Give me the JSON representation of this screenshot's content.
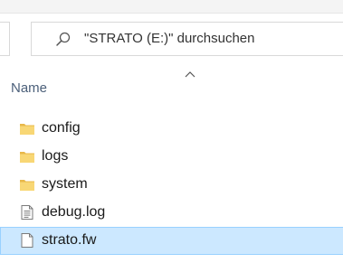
{
  "search": {
    "placeholder": "\"STRATO (E:)\" durchsuchen"
  },
  "columns": {
    "name": "Name"
  },
  "files": [
    {
      "name": "config",
      "type": "folder"
    },
    {
      "name": "logs",
      "type": "folder"
    },
    {
      "name": "system",
      "type": "folder"
    },
    {
      "name": "debug.log",
      "type": "text-file"
    },
    {
      "name": "strato.fw",
      "type": "file",
      "selected": true
    }
  ],
  "colors": {
    "folder_yellow": "#f8d775",
    "selection_fill": "#cce8ff",
    "selection_border": "#99d1ff",
    "header_text": "#4c607a"
  }
}
